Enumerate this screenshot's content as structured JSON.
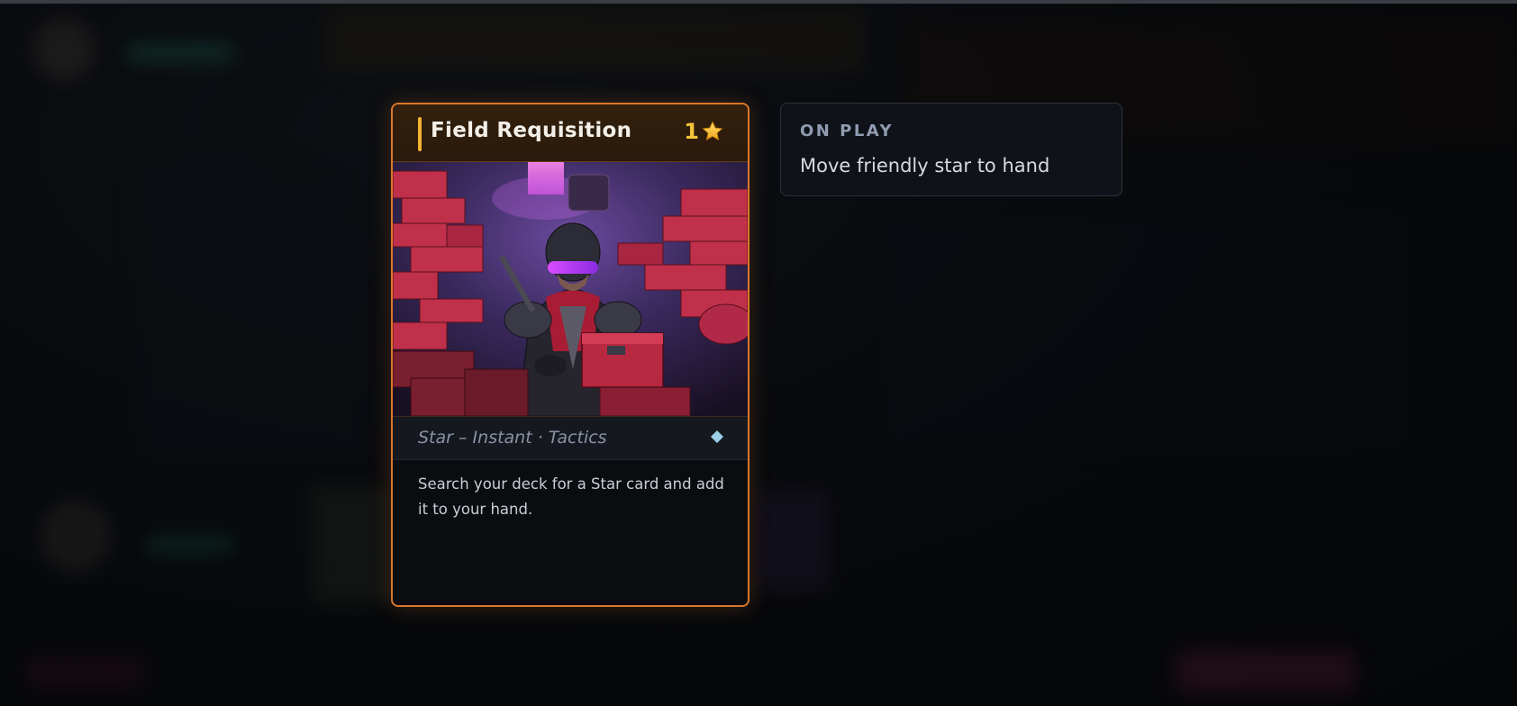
{
  "card": {
    "title": "Field Requisition",
    "cost": "1",
    "cost_icon": "star-icon",
    "type_line": "Star – Instant · Tactics",
    "rarity_icon": "diamond-icon",
    "rules_text": "Search your deck for a Star card and add it to your hand.",
    "art": "soldier-in-supply-depot-illustration",
    "border_color": "#d9772b",
    "cost_color": "#f4c43a",
    "accent_color": "#f2b233"
  },
  "effect_panel": {
    "heading": "ON PLAY",
    "text": "Move friendly star to hand"
  }
}
